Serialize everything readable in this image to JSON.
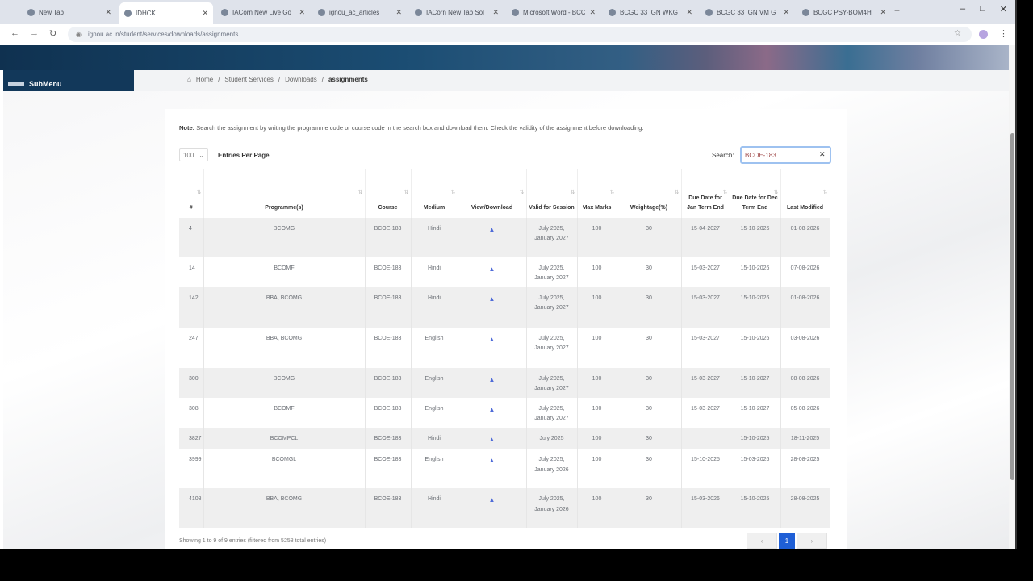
{
  "browser": {
    "tabs": [
      {
        "title": "New Tab"
      },
      {
        "title": "IDHCK"
      },
      {
        "title": "IACorn New Live Go"
      },
      {
        "title": "ignou_ac_articles"
      },
      {
        "title": "IACorn New Tab Sol"
      },
      {
        "title": "Microsoft Word - BCC"
      },
      {
        "title": "BCGC 33 IGN WKG"
      },
      {
        "title": "BCGC 33 IGN VM G"
      },
      {
        "title": "BCGC PSY-BOM4H"
      }
    ],
    "new_tab": "+",
    "url": "ignou.ac.in/student/services/downloads/assignments"
  },
  "site": {
    "submenu_label": "SubMenu",
    "breadcrumb": [
      "Home",
      "Student Services",
      "Downloads",
      "assignments"
    ]
  },
  "page": {
    "note_label": "Note:",
    "note_text": "Search the assignment by writing the programme code or course code in the search box and download them. Check the validity of the assignment before downloading.",
    "entries_value": "100",
    "entries_label": "Entries Per Page",
    "search_label": "Search:",
    "search_value": "BCOE-183",
    "showing_text": "Showing 1 to 9 of 9 entries (filtered from 5258 total entries)",
    "pager": {
      "prev": "‹",
      "current": "1",
      "next": "›"
    }
  },
  "table": {
    "headers": [
      "#",
      "Programme(s)",
      "Course",
      "Medium",
      "View/Download",
      "Valid for Session",
      "Max Marks",
      "Weightage(%)",
      "Due Date for Jan Term End",
      "Due Date for Dec Term End",
      "Last Modified"
    ],
    "rows": [
      [
        "4",
        "BCOMG",
        "BCOE-183",
        "Hindi",
        "July 2025, January 2027",
        "100",
        "30",
        "15-04-2027",
        "15-10-2026",
        "01-08-2026"
      ],
      [
        "14",
        "BCOMF",
        "BCOE-183",
        "Hindi",
        "July 2025, January 2027",
        "100",
        "30",
        "15-03-2027",
        "15-10-2026",
        "07-08-2026"
      ],
      [
        "142",
        "BBA, BCOMG",
        "BCOE-183",
        "Hindi",
        "July 2025, January 2027",
        "100",
        "30",
        "15-03-2027",
        "15-10-2026",
        "01-08-2026"
      ],
      [
        "247",
        "BBA, BCOMG",
        "BCOE-183",
        "English",
        "July 2025, January 2027",
        "100",
        "30",
        "15-03-2027",
        "15-10-2026",
        "03-08-2026"
      ],
      [
        "300",
        "BCOMG",
        "BCOE-183",
        "English",
        "July 2025, January 2027",
        "100",
        "30",
        "15-03-2027",
        "15-10-2027",
        "08-08-2026"
      ],
      [
        "308",
        "BCOMF",
        "BCOE-183",
        "English",
        "July 2025, January 2027",
        "100",
        "30",
        "15-03-2027",
        "15-10-2027",
        "05-08-2026"
      ],
      [
        "3827",
        "BCOMPCL",
        "BCOE-183",
        "Hindi",
        "July 2025",
        "100",
        "30",
        "",
        "15-10-2025",
        "18-11-2025"
      ],
      [
        "3999",
        "BCOMGL",
        "BCOE-183",
        "English",
        "July 2025, January 2026",
        "100",
        "30",
        "15-10-2025",
        "15-03-2026",
        "28-08-2025"
      ],
      [
        "4108",
        "BBA, BCOMG",
        "BCOE-183",
        "Hindi",
        "July 2025, January 2026",
        "100",
        "30",
        "15-03-2026",
        "15-10-2025",
        "28-08-2025"
      ]
    ]
  }
}
